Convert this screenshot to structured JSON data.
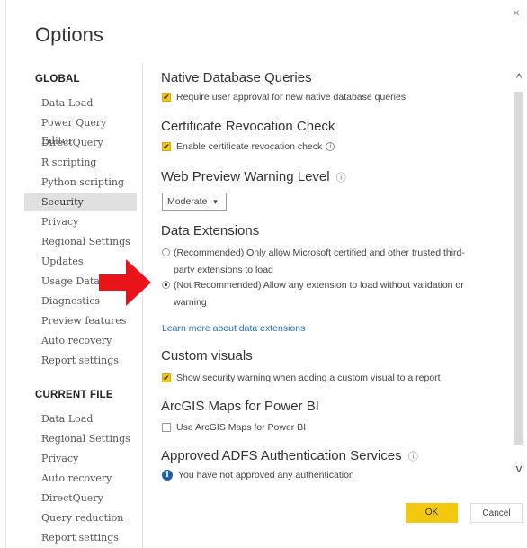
{
  "dialog": {
    "title": "Options",
    "close_glyph": "×"
  },
  "nav": {
    "global_header": "GLOBAL",
    "global_items": [
      "Data Load",
      "Power Query Editor",
      "DirectQuery",
      "R scripting",
      "Python scripting",
      "Security",
      "Privacy",
      "Regional Settings",
      "Updates",
      "Usage Data",
      "Diagnostics",
      "Preview features",
      "Auto recovery",
      "Report settings"
    ],
    "selected": "Security",
    "current_header": "CURRENT FILE",
    "current_items": [
      "Data Load",
      "Regional Settings",
      "Privacy",
      "Auto recovery",
      "DirectQuery",
      "Query reduction",
      "Report settings"
    ]
  },
  "sections": {
    "native_db": {
      "title": "Native Database Queries",
      "checkbox_label": "Require user approval for new native database queries",
      "checked": true
    },
    "cert_revocation": {
      "title": "Certificate Revocation Check",
      "checkbox_label": "Enable certificate revocation check",
      "checked": true
    },
    "web_preview": {
      "title": "Web Preview Warning Level",
      "dropdown_value": "Moderate",
      "dropdown_arrow": "▾"
    },
    "data_extensions": {
      "title": "Data Extensions",
      "option1_line1": "(Recommended) Only allow Microsoft certified and other trusted third-",
      "option1_line2": "party extensions to load",
      "option2_line1": "(Not Recommended) Allow any extension to load without validation or",
      "option2_line2": "warning",
      "selected_option": 2,
      "link": "Learn more about data extensions"
    },
    "custom_visuals": {
      "title": "Custom visuals",
      "checkbox_label": "Show security warning when adding a custom visual to a report",
      "checked": true
    },
    "arcgis": {
      "title": "ArcGIS Maps for Power BI",
      "checkbox_label": "Use ArcGIS Maps for Power BI",
      "checked": false
    },
    "adfs": {
      "title": "Approved ADFS Authentication Services",
      "message": "You have not approved any authentication"
    }
  },
  "buttons": {
    "ok": "OK",
    "cancel": "Cancel"
  },
  "icons": {
    "info": "ⓘ",
    "check": "✔",
    "info_filled": "i",
    "scroll_up": "^",
    "scroll_down": "v"
  },
  "colors": {
    "accent": "#f2c811",
    "link": "#1e6fc0",
    "arrow": "#e8141a",
    "selected_nav": "#e1e1e1"
  }
}
